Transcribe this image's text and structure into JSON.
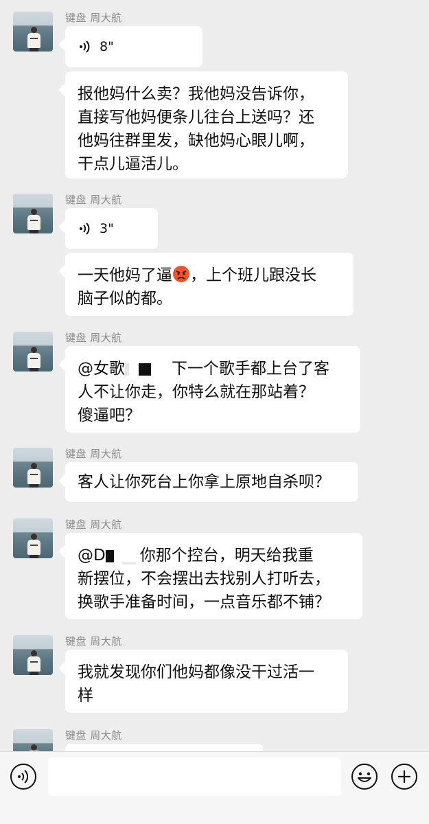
{
  "messages": [
    {
      "sender": "键盘 周大航",
      "type": "voice",
      "duration": "8\""
    },
    {
      "type": "text",
      "lines": [
        "报他妈什么卖？我他妈没告诉你，",
        "直接写他妈便条儿往台上送吗？还",
        "他妈往群里发，缺他妈心眼儿啊，",
        "干点儿逼活儿。"
      ]
    },
    {
      "sender": "键盘 周大航",
      "type": "voice",
      "duration": "3\""
    },
    {
      "type": "text",
      "line1_before": "一天他妈了逼",
      "line1_after": "，上个班儿跟没长",
      "line2": "脑子似的都。"
    },
    {
      "sender": "键盘 周大航",
      "type": "text",
      "line1_prefix": "@女歌",
      "line1_suffix": "下一个歌手都上台了客",
      "line2": "人不让你走，你特么就在那站着？",
      "line3": "傻逼吧？"
    },
    {
      "sender": "键盘 周大航",
      "type": "text",
      "line1": "客人让你死台上你拿上原地自杀呗？"
    },
    {
      "sender": "键盘 周大航",
      "type": "text",
      "line1_prefix": "@D",
      "line1_suffix": "你那个控台，明天给我重",
      "line2": "新摆位，不会摆出去找别人打听去，",
      "line3": "换歌手准备时间，一点音乐都不铺？"
    },
    {
      "sender": "键盘 周大航",
      "type": "text",
      "line1": "我就发现你们他妈都像没干过活一",
      "line2": "样"
    },
    {
      "sender": "键盘 周大航",
      "type": "partial"
    }
  ],
  "input": {
    "value": ""
  },
  "icons": {
    "voice_toggle": "voice-icon",
    "emoji": "emoji-icon",
    "more": "plus-icon"
  },
  "colors": {
    "background": "#ededed",
    "bubble": "#ffffff",
    "sender_text": "#8a8a8a",
    "input_bar": "#f6f6f6"
  }
}
